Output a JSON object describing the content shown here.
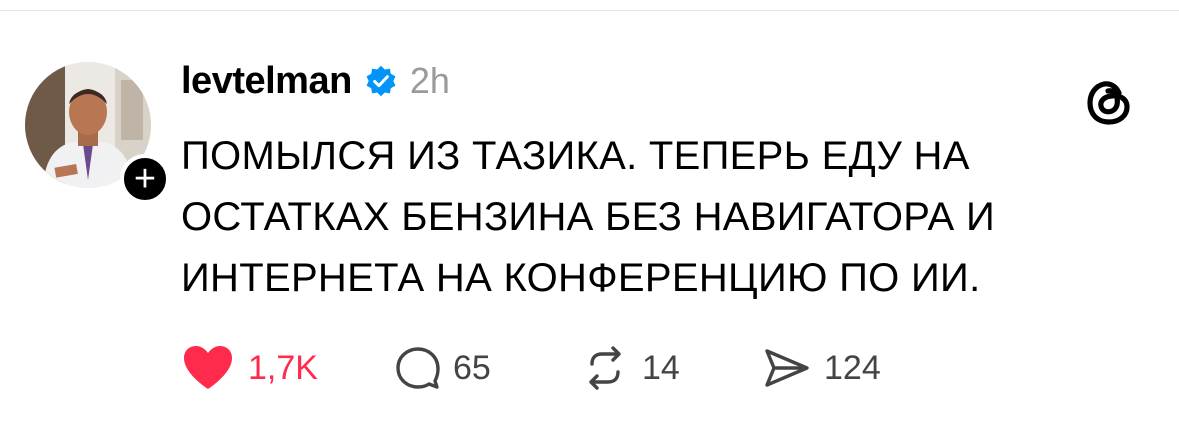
{
  "post": {
    "username": "levtelman",
    "time_ago": "2h",
    "text_lines": [
      "ПОМЫЛСЯ ИЗ ТАЗИКА. ТЕПЕРЬ ЕДУ НА",
      "ОСТАТКАХ БЕНЗИНА БЕЗ НАВИГАТОРА И",
      "ИНТЕРНЕТА НА КОНФЕРЕНЦИЮ ПО ИИ."
    ],
    "follow_symbol": "+"
  },
  "actions": {
    "likes": "1,7K",
    "replies": "65",
    "reposts": "14",
    "shares": "124"
  },
  "icons": {
    "verified": "verified-badge-icon",
    "logo": "threads-logo-icon",
    "like": "heart-icon",
    "reply": "speech-bubble-icon",
    "repost": "repost-arrows-icon",
    "share": "send-arrow-icon"
  },
  "colors": {
    "like": "#ff2b4c",
    "verified": "#0095f6",
    "secondary_text": "#9a9a9a"
  }
}
